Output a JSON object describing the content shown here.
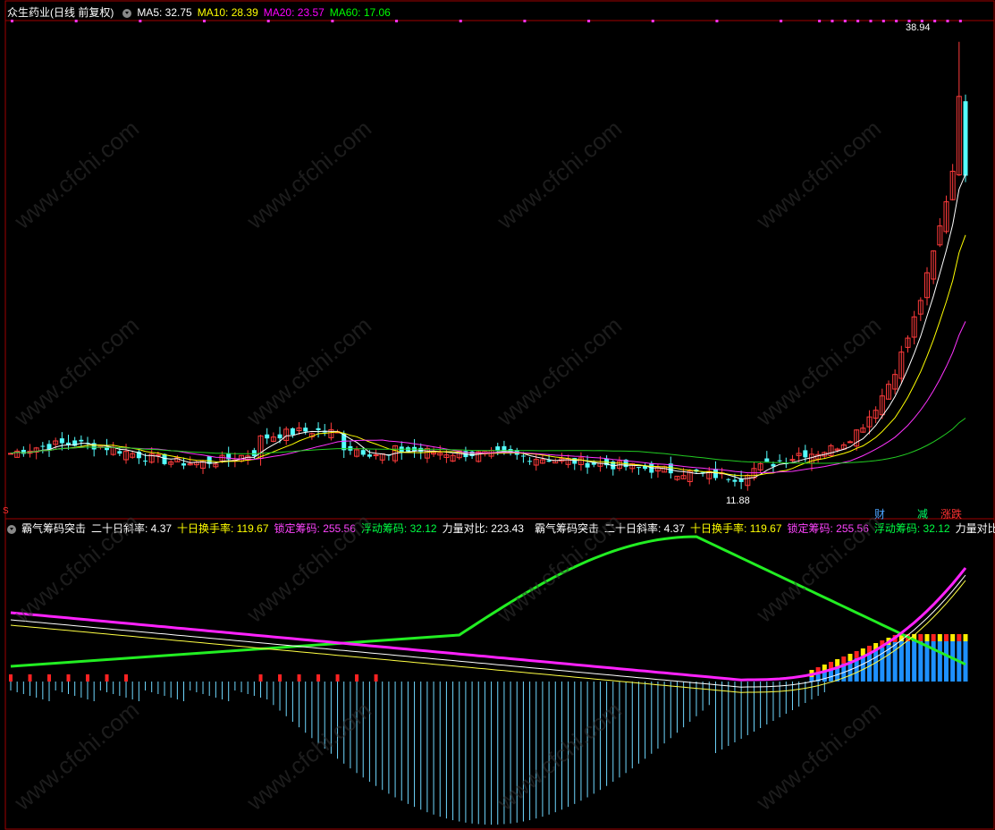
{
  "stock_title": "众生药业(日线 前复权)",
  "ma_labels": [
    {
      "name": "MA5",
      "value": "32.75",
      "color": "#ffffff"
    },
    {
      "name": "MA10",
      "value": "28.39",
      "color": "#ffff00"
    },
    {
      "name": "MA20",
      "value": "23.57",
      "color": "#ff00ff"
    },
    {
      "name": "MA60",
      "value": "17.06",
      "color": "#00ff00"
    }
  ],
  "price_high_label": "38.94",
  "price_low_label": "11.88",
  "side_marker": "S",
  "bottom_buttons": [
    {
      "label": "财",
      "color": "#4aa3ff"
    },
    {
      "label": "减",
      "color": "#00ff66"
    },
    {
      "label": "涨跌",
      "color": "#ff3333"
    }
  ],
  "indicator_name": "霸气筹码突击",
  "indicator_values": [
    {
      "name": "二十日斜率",
      "value": "4.37",
      "color": "#ffffff"
    },
    {
      "name": "十日换手率",
      "value": "119.67",
      "color": "#ffff00"
    },
    {
      "name": "锁定筹码",
      "value": "255.56",
      "color": "#ff44ff"
    },
    {
      "name": "浮动筹码",
      "value": "32.12",
      "color": "#00ff44"
    },
    {
      "name": "力量对比",
      "value": "223.43",
      "color": "#ffffff"
    }
  ],
  "indicator_name_repeat": "霸气筹码突击",
  "indicator_values_repeat": [
    {
      "name": "二十日斜率",
      "value": "4.37",
      "color": "#ffffff"
    },
    {
      "name": "十日换手率",
      "value": "119.67",
      "color": "#ffff00"
    },
    {
      "name": "锁定筹码",
      "value": "255.56",
      "color": "#ff44ff"
    },
    {
      "name": "浮动筹码",
      "value": "32.12",
      "color": "#00ff44"
    },
    {
      "name": "力量对比:",
      "value": "",
      "color": "#ffffff"
    }
  ],
  "watermark": "www.cfchi.com",
  "colors": {
    "up": "#ff3b3b",
    "down": "#54ffff",
    "ma5": "#ffffff",
    "ma10": "#ffff00",
    "ma20": "#ff33ff",
    "ma60": "#22cc22",
    "frame": "#b00000"
  }
}
